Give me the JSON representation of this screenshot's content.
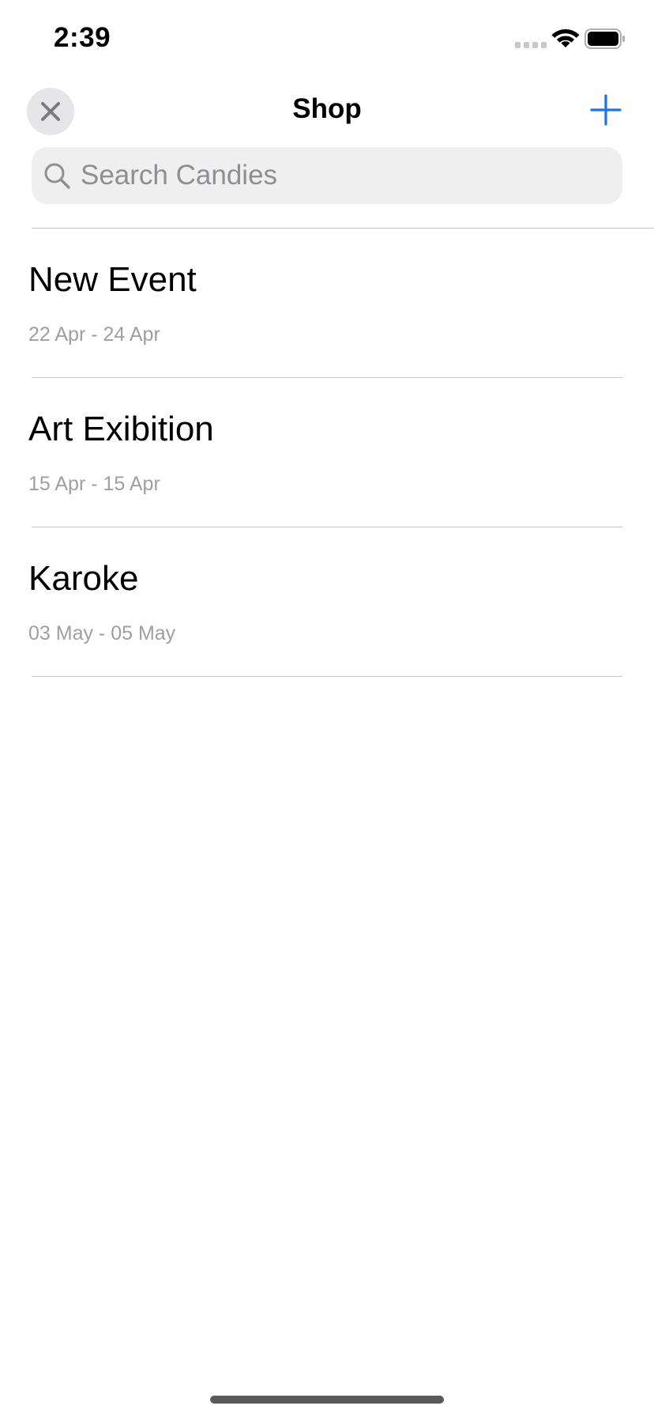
{
  "status_bar": {
    "time": "2:39"
  },
  "nav": {
    "title": "Shop",
    "close_icon": "close-icon",
    "add_icon": "plus-icon",
    "accent_color": "#1a73e8"
  },
  "search": {
    "placeholder": "Search Candies",
    "value": ""
  },
  "events": [
    {
      "title": "New Event",
      "dates": "22 Apr - 24 Apr"
    },
    {
      "title": "Art Exibition",
      "dates": "15 Apr - 15 Apr"
    },
    {
      "title": "Karoke",
      "dates": "03 May - 05 May"
    }
  ]
}
